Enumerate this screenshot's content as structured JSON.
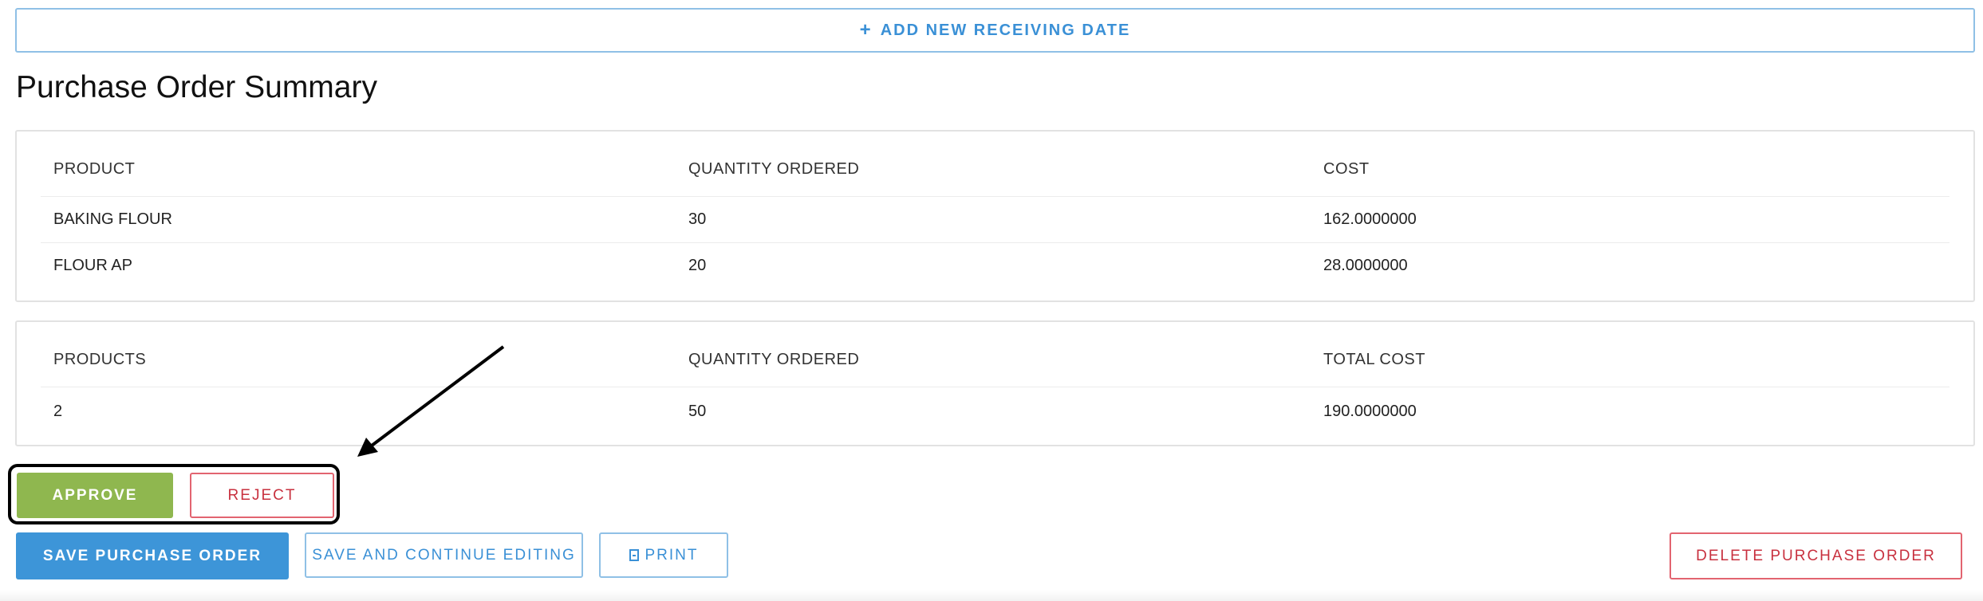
{
  "add_receiving_date": {
    "label": "ADD NEW RECEIVING DATE",
    "icon": "plus-icon"
  },
  "title": "Purchase Order Summary",
  "items_table": {
    "headers": [
      "PRODUCT",
      "QUANTITY ORDERED",
      "COST"
    ],
    "rows": [
      [
        "BAKING FLOUR",
        "30",
        "162.0000000"
      ],
      [
        "FLOUR AP",
        "20",
        "28.0000000"
      ]
    ]
  },
  "totals_table": {
    "headers": [
      "PRODUCTS",
      "QUANTITY ORDERED",
      "TOTAL COST"
    ],
    "rows": [
      [
        "2",
        "50",
        "190.0000000"
      ]
    ]
  },
  "approval": {
    "approve_label": "APPROVE",
    "reject_label": "REJECT"
  },
  "actions": {
    "save_label": "SAVE PURCHASE ORDER",
    "continue_label": "SAVE AND CONTINUE EDITING",
    "print_label": "PRINT",
    "print_icon": "document-icon",
    "delete_label": "DELETE PURCHASE ORDER"
  },
  "colors": {
    "primary": "#3d95d8",
    "approve": "#8fb74f",
    "danger": "#c8313f"
  }
}
